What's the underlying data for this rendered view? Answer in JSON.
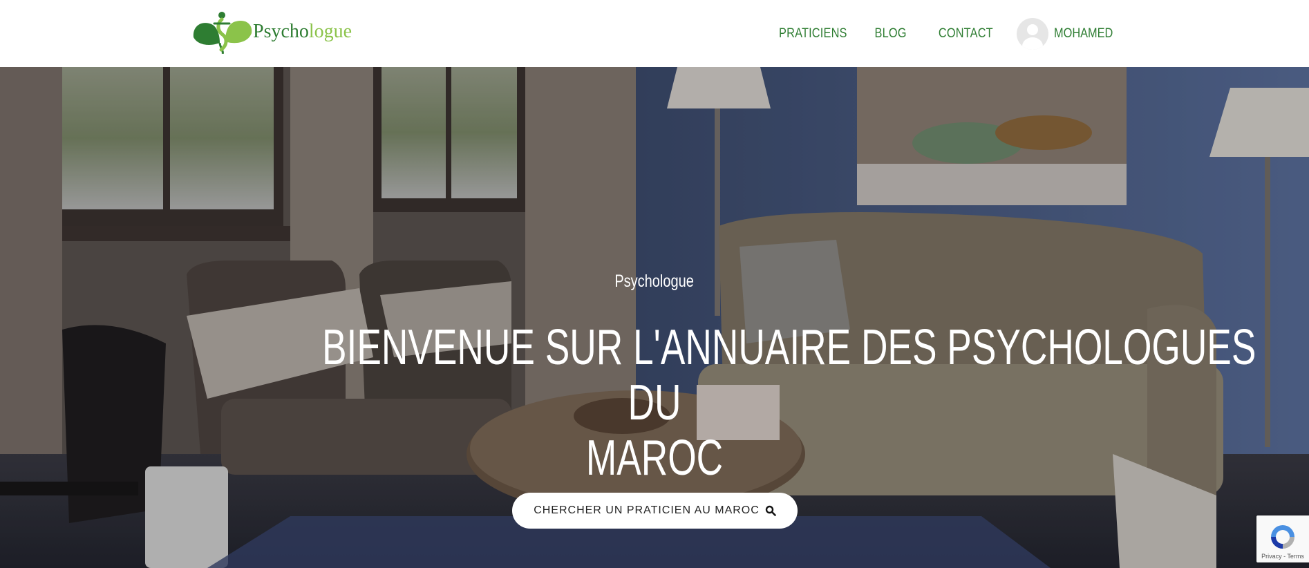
{
  "brand": {
    "name_part1": "Psycho",
    "name_part2": "logue",
    "primary_color": "#2e7d32",
    "accent_color": "#8bc34a"
  },
  "nav": {
    "items": [
      {
        "label": "PRATICIENS"
      },
      {
        "label": "BLOG"
      },
      {
        "label": "CONTACT"
      }
    ],
    "user": {
      "name": "MOHAMED",
      "icon": "user-avatar-icon"
    }
  },
  "hero": {
    "subtitle": "Psychologue",
    "title_line1": "BIENVENUE SUR L'ANNUAIRE DES PSYCHOLOGUES",
    "title_line2": "DU",
    "title_line3": "MAROC",
    "search_button_label": "CHERCHER UN PRATICIEN AU MAROC",
    "search_icon": "search-icon"
  },
  "recaptcha": {
    "links": "Privacy - Terms"
  }
}
